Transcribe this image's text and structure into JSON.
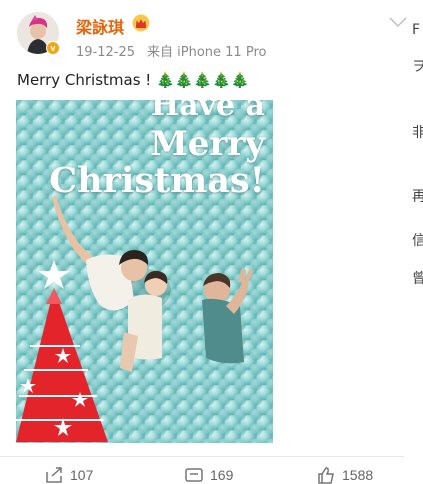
{
  "post": {
    "author": "梁詠琪",
    "date": "19-12-25",
    "source": "来自 iPhone 11 Pro",
    "text": "Merry Christmas ! 🎄🎄🎄🎄🎄",
    "image_text": [
      "Have a",
      "Merry",
      "Christmas!"
    ],
    "icons": {
      "avatar": "user-avatar",
      "verified": "verified-v-badge",
      "crown": "crown-icon",
      "menu": "chevron-down-icon"
    }
  },
  "actions": {
    "repost_count": "107",
    "comment_count": "169",
    "like_count": "1588"
  },
  "colors": {
    "username": "#e8640a",
    "balls": "#8fd3d2",
    "tree": "#e3242b"
  }
}
